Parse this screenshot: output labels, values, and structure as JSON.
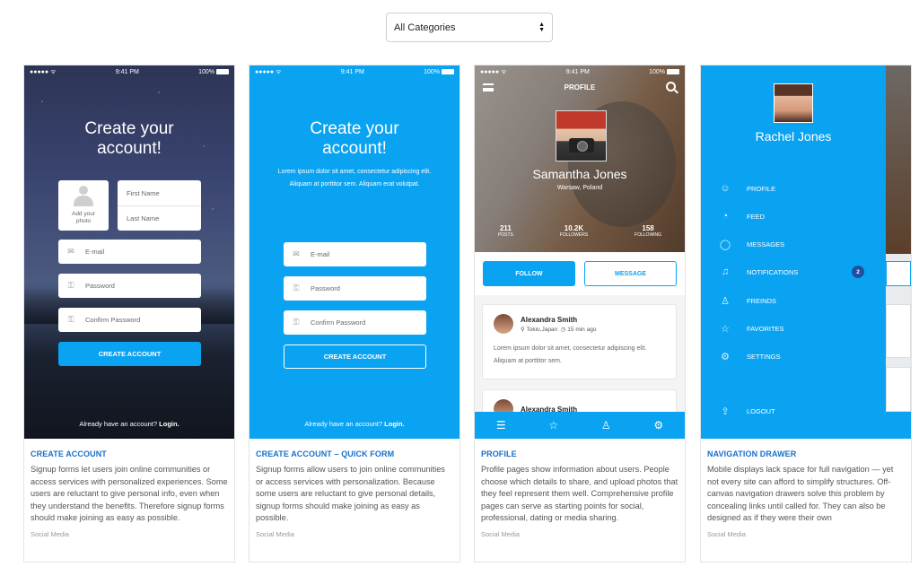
{
  "filter": {
    "selected": "All Categories"
  },
  "status": {
    "time": "9:41 PM",
    "battery": "100%",
    "signal": "●●●●● ᯤ"
  },
  "cards": [
    {
      "title": "CREATE ACCOUNT",
      "description": "Signup forms let users join online communities or access services with personalized experiences. Some users are reluctant to give personal info, even when they understand the benefits. Therefore signup forms should make joining as easy as possible.",
      "tag": "Social Media",
      "screen": {
        "heading_line1": "Create your",
        "heading_line2": "account!",
        "add_photo": "Add your photo",
        "first_name": "First Name",
        "last_name": "Last Name",
        "email": "E-mail",
        "password": "Password",
        "confirm_password": "Confirm Password",
        "cta": "CREATE ACCOUNT",
        "footer_text": "Already have an account?",
        "footer_link": "Login."
      }
    },
    {
      "title": "CREATE ACCOUNT – QUICK FORM",
      "description": "Signup forms allow users to join online communities or access services with personalization. Because some users are reluctant to give personal details, signup forms should make joining as easy as possible.",
      "tag": "Social Media",
      "screen": {
        "heading_line1": "Create your",
        "heading_line2": "account!",
        "lorem": "Lorem ipsum dolor sit amet, consectetur adipiscing elit. Aliquam at porttitor sem. Aliquam erat volutpat.",
        "email": "E-mail",
        "password": "Password",
        "confirm_password": "Confirm Password",
        "cta": "CREATE ACCOUNT",
        "footer_text": "Already have an account?",
        "footer_link": "Login."
      }
    },
    {
      "title": "PROFILE",
      "description": "Profile pages show information about users. People choose which details to share, and upload photos that they feel represent them well. Comprehensive profile pages can serve as starting points for social, professional, dating or media sharing.",
      "tag": "Social Media",
      "screen": {
        "header": "PROFILE",
        "name": "Samantha Jones",
        "location": "Warsaw, Poland",
        "stats": [
          {
            "value": "211",
            "label": "POSTS"
          },
          {
            "value": "10.2K",
            "label": "FOLLOWERS"
          },
          {
            "value": "158",
            "label": "FOLLOWING"
          }
        ],
        "follow": "FOLLOW",
        "message": "MESSAGE",
        "posts": [
          {
            "author": "Alexandra Smith",
            "place": "Tokio,Japan",
            "time": "15 min ago",
            "text": "Lorem ipsum dolor sit amet, consectetur adipiscing elit. Aliquam at porttitor sem."
          },
          {
            "author": "Alexandra Smith"
          }
        ]
      }
    },
    {
      "title": "NAVIGATION DRAWER",
      "description": "Mobile displays lack space for full navigation — yet not every site can afford to simplify structures. Off-canvas navigation drawers solve this problem by concealing links until called for. They can also be designed as if they were their own",
      "tag": "Social Media",
      "screen": {
        "user": "Rachel Jones",
        "items": [
          {
            "label": "PROFILE",
            "icon": "profile-icon"
          },
          {
            "label": "FEED",
            "icon": "feed-icon"
          },
          {
            "label": "MESSAGES",
            "icon": "message-icon"
          },
          {
            "label": "NOTIFICATIONS",
            "icon": "bell-icon",
            "badge": "2"
          },
          {
            "label": "FREINDS",
            "icon": "friends-icon"
          },
          {
            "label": "FAVORITES",
            "icon": "star-icon"
          },
          {
            "label": "SETTINGS",
            "icon": "gear-icon"
          }
        ],
        "logout": "LOGOUT"
      }
    }
  ],
  "colors": {
    "accent": "#0aa3f2",
    "title": "#1a6fc9"
  }
}
